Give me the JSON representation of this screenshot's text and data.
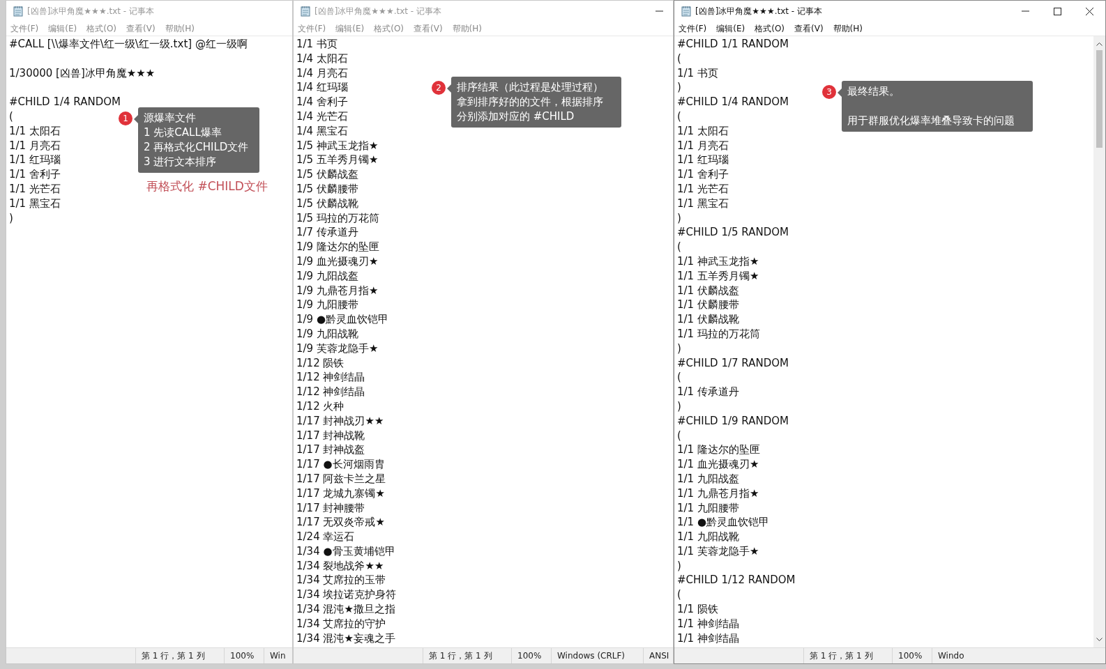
{
  "windows": [
    {
      "title": "[凶兽]冰甲角魔★★★.txt - 记事本",
      "active": false,
      "menu": [
        "文件(F)",
        "编辑(E)",
        "格式(O)",
        "查看(V)",
        "帮助(H)"
      ],
      "blocks": [
        [
          "#CALL [\\\\爆率文件\\红一级\\红一级.txt] @红一级啊"
        ],
        [
          "1/30000 [凶兽]冰甲角魔★★★"
        ],
        [
          "#CHILD 1/4 RANDOM",
          "(",
          "1/1 太阳石",
          "1/1 月亮石",
          "1/1 红玛瑙",
          "1/1 舍利子",
          "1/1 光芒石",
          "1/1 黑宝石",
          ")"
        ]
      ],
      "scrollbar": false,
      "status": [
        "第 1 行，第 1 列",
        "100%",
        "Win"
      ]
    },
    {
      "title": "[凶兽]冰甲角魔★★★.txt - 记事本",
      "active": false,
      "minimize_button": true,
      "menu": [
        "文件(F)",
        "编辑(E)",
        "格式(O)",
        "查看(V)",
        "帮助(H)"
      ],
      "blocks": [
        [
          "1/1 书页",
          "1/4 太阳石",
          "1/4 月亮石",
          "1/4 红玛瑙",
          "1/4 舍利子",
          "1/4 光芒石",
          "1/4 黑宝石",
          "1/5 神武玉龙指★",
          "1/5 五羊秀月镯★",
          "1/5 伏麟战盔",
          "1/5 伏麟腰带",
          "1/5 伏麟战靴",
          "1/5 玛拉的万花筒",
          "1/7 传承道丹",
          "1/9 隆达尔的坠匣",
          "1/9 血光摄魂刃★",
          "1/9 九阳战盔",
          "1/9 九鼎苍月指★",
          "1/9 九阳腰带",
          "1/9 ●黔灵血饮铠甲",
          "1/9 九阳战靴",
          "1/9 芙蓉龙隐手★",
          "1/12 陨铁",
          "1/12 神剑结晶",
          "1/12 神剑结晶",
          "1/12 火种",
          "1/17 封神战刃★★",
          "1/17 封神战靴",
          "1/17 封神战盔",
          "1/17 ●长河烟雨胄",
          "1/17 阿兹卡兰之星",
          "1/17 龙城九寨镯★",
          "1/17 封神腰带",
          "1/17 无双炎帝戒★",
          "1/24 幸运石",
          "1/34 ●骨玉黄埔铠甲",
          "1/34 裂地战斧★★",
          "1/34 艾席拉的玉带",
          "1/34 埃拉诺克护身符",
          "1/34 混沌★撒旦之指",
          "1/34 艾席拉的守护",
          "1/34 混沌★妄魂之手"
        ]
      ],
      "scrollbar": false,
      "status": [
        "第 1 行，第 1 列",
        "100%",
        "Windows (CRLF)",
        "ANSI"
      ]
    },
    {
      "title": "[凶兽]冰甲角魔★★★.txt - 记事本",
      "active": true,
      "minimize_button": true,
      "maximize_button": true,
      "close_button": true,
      "menu": [
        "文件(F)",
        "编辑(E)",
        "格式(O)",
        "查看(V)",
        "帮助(H)"
      ],
      "blocks": [
        [
          "#CHILD 1/1 RANDOM",
          "(",
          "1/1 书页",
          ")",
          "#CHILD 1/4 RANDOM",
          "(",
          "1/1 太阳石",
          "1/1 月亮石",
          "1/1 红玛瑙",
          "1/1 舍利子",
          "1/1 光芒石",
          "1/1 黑宝石",
          ")",
          "#CHILD 1/5 RANDOM",
          "(",
          "1/1 神武玉龙指★",
          "1/1 五羊秀月镯★",
          "1/1 伏麟战盔",
          "1/1 伏麟腰带",
          "1/1 伏麟战靴",
          "1/1 玛拉的万花筒",
          ")",
          "#CHILD 1/7 RANDOM",
          "(",
          "1/1 传承道丹",
          ")",
          "#CHILD 1/9 RANDOM",
          "(",
          "1/1 隆达尔的坠匣",
          "1/1 血光摄魂刃★",
          "1/1 九阳战盔",
          "1/1 九鼎苍月指★",
          "1/1 九阳腰带",
          "1/1 ●黔灵血饮铠甲",
          "1/1 九阳战靴",
          "1/1 芙蓉龙隐手★",
          ")",
          "#CHILD 1/12 RANDOM",
          "(",
          "1/1 陨铁",
          "1/1 神剑结晶",
          "1/1 神剑结晶"
        ]
      ],
      "scrollbar": true,
      "status": [
        "第 1 行，第 1 列",
        "100%",
        "Windo"
      ]
    }
  ],
  "red_note": "再格式化 #CHILD文件",
  "callouts": [
    {
      "number": "1",
      "paragraphs": [
        [
          "源爆率文件",
          "1 先读CALL爆率",
          "2 再格式化CHILD文件",
          "3 进行文本排序"
        ]
      ]
    },
    {
      "number": "2",
      "paragraphs": [
        [
          "排序结果（此过程是处理过程）",
          "拿到排序好的的文件，根据排序",
          "分别添加对应的 #CHILD"
        ]
      ]
    },
    {
      "number": "3",
      "paragraphs": [
        [
          "最终结果。"
        ],
        [
          "用于群服优化爆率堆叠导致卡的问题"
        ]
      ]
    }
  ]
}
